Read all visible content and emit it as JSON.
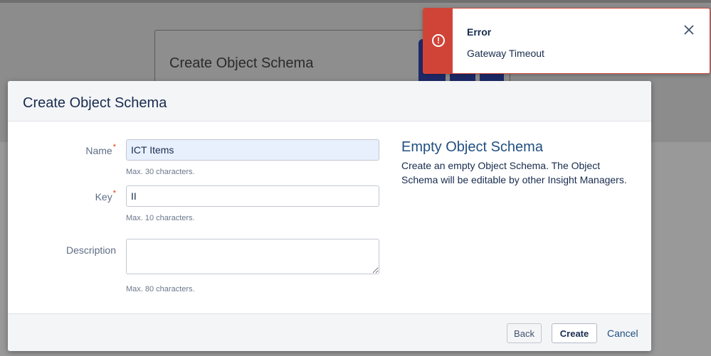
{
  "background": {
    "card_title": "Create Object Schema"
  },
  "dialog": {
    "title": "Create Object Schema",
    "form": {
      "name": {
        "label": "Name",
        "required_marker": "*",
        "value": "ICT Items",
        "hint": "Max. 30 characters."
      },
      "key": {
        "label": "Key",
        "required_marker": "*",
        "value": "II",
        "hint": "Max. 10 characters."
      },
      "description": {
        "label": "Description",
        "value": "",
        "hint": "Max. 80 characters."
      }
    },
    "side_panel": {
      "title": "Empty Object Schema",
      "description": "Create an empty Object Schema. The Object Schema will be editable by other Insight Managers."
    },
    "footer": {
      "back_label": "Back",
      "create_label": "Create",
      "cancel_label": "Cancel"
    }
  },
  "flag": {
    "icon": "error-icon",
    "title": "Error",
    "message": "Gateway Timeout",
    "close_icon": "close-icon"
  },
  "colors": {
    "error": "#d04437",
    "link": "#205081",
    "text": "#172b4d"
  }
}
